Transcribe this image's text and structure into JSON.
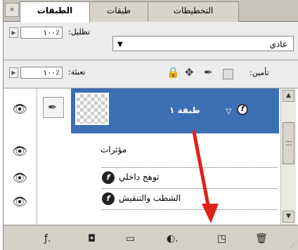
{
  "tabs": [
    {
      "label": "الطبقات",
      "active": true
    },
    {
      "label": "طبقات"
    },
    {
      "label": "التخطيطات"
    }
  ],
  "tabstrip": {
    "collapse_label": "»"
  },
  "blend": {
    "mode_value": "عادي",
    "opacity_label": "تظليل:",
    "opacity_value": "١٠٠٪"
  },
  "lock": {
    "label": "تأمين:",
    "fill_label": "تعبئة:",
    "fill_value": "١٠٠٪"
  },
  "layers": [
    {
      "name": "طبقة ١",
      "selected": true,
      "effects_label": "مؤثرات",
      "effects": [
        {
          "name": "توهج داخلي"
        },
        {
          "name": "الشطب والتنقيش"
        }
      ]
    }
  ],
  "icons": {
    "eye": "eye-icon",
    "brush": "brush-icon",
    "fx": "fx-icon",
    "lock": "lock-icon",
    "move": "move-icon",
    "trash": "trash-icon"
  },
  "colors": {
    "selected_row": "#3d6fb5",
    "annotation_arrow": "#e0201b"
  }
}
